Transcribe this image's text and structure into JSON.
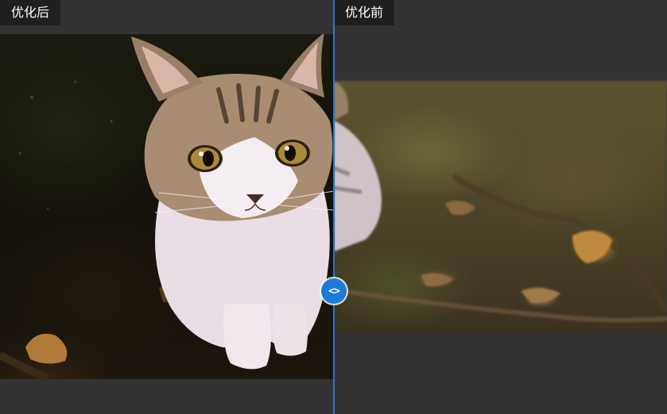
{
  "labels": {
    "after": "优化后",
    "before": "优化前"
  },
  "handle": {
    "glyph": "<>",
    "icon": "chevron-left-right-icon"
  },
  "colors": {
    "background": "#333333",
    "label_bg": "#1f1f1f",
    "label_text": "#ffffff",
    "accent": "#1e7ad8"
  },
  "images": {
    "after": {
      "subject": "cat-photo",
      "state": "enhanced"
    },
    "before": {
      "subject": "cat-photo",
      "state": "original"
    }
  }
}
